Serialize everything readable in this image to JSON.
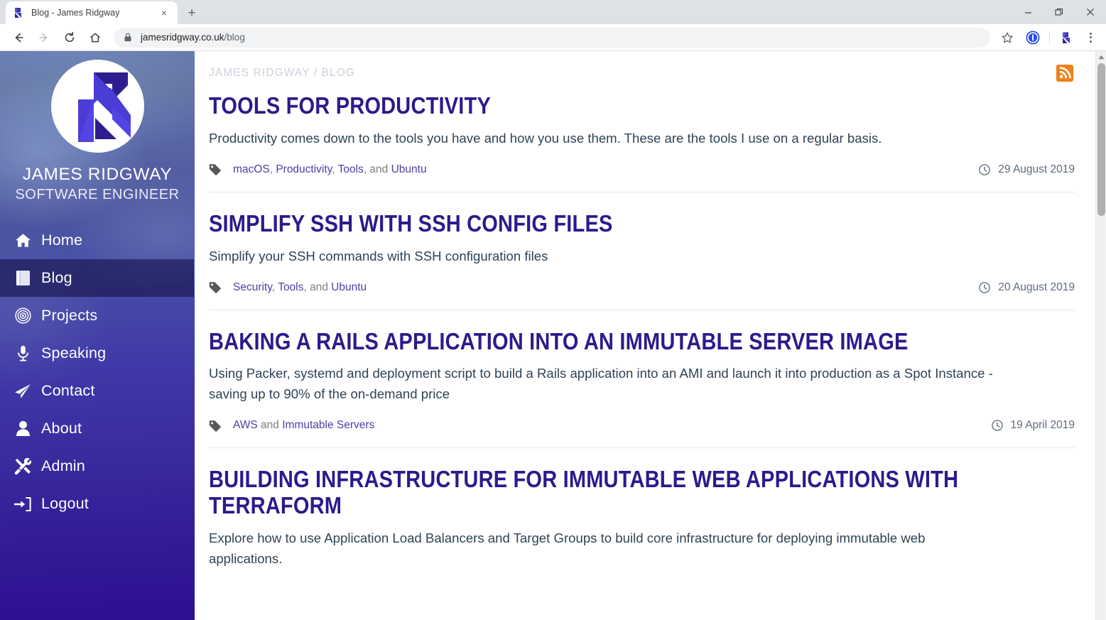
{
  "browser": {
    "tab": {
      "title": "Blog - James Ridgway",
      "favicon_name": "site-logo-favicon",
      "close_label": "×"
    },
    "new_tab_label": "+",
    "window_controls": {
      "minimize_label": "–",
      "maximize_label": "❐",
      "close_label": "✕"
    },
    "nav": {
      "back_label": "←",
      "forward_label": "→",
      "reload_label": "↻",
      "home_label": "⌂"
    },
    "omnibox": {
      "domain": "jamesridgway.co.uk",
      "path": "/blog",
      "lock_icon": "padlock-icon"
    },
    "actions": {
      "bookmark_label": "☆",
      "onepassword_label": "1Password",
      "profile_label": "Profile",
      "menu_label": "Customise and control Google Chrome"
    }
  },
  "sidebar": {
    "brand_name": "JAMES RIDGWAY",
    "brand_role": "SOFTWARE ENGINEER",
    "logo_name": "james-ridgway-logo",
    "items": [
      {
        "label": "Home",
        "icon": "home-icon",
        "active": false
      },
      {
        "label": "Blog",
        "icon": "book-icon",
        "active": true
      },
      {
        "label": "Projects",
        "icon": "bullseye-icon",
        "active": false
      },
      {
        "label": "Speaking",
        "icon": "microphone-icon",
        "active": false
      },
      {
        "label": "Contact",
        "icon": "paper-plane-icon",
        "active": false
      },
      {
        "label": "About",
        "icon": "user-icon",
        "active": false
      },
      {
        "label": "Admin",
        "icon": "tools-icon",
        "active": false
      },
      {
        "label": "Logout",
        "icon": "sign-out-icon",
        "active": false
      }
    ]
  },
  "main": {
    "breadcrumb": "JAMES RIDGWAY / BLOG",
    "rss_label": "RSS Feed",
    "posts": [
      {
        "title": "Tools for Productivity",
        "excerpt": "Productivity comes down to the tools you have and how you use them. These are the tools I use on a regular basis.",
        "tags": [
          "macOS",
          "Productivity",
          "Tools",
          "Ubuntu"
        ],
        "tags_text": "macOS, Productivity, Tools, and Ubuntu",
        "date": "29 August 2019"
      },
      {
        "title": "Simplify SSH with SSH Config Files",
        "excerpt": "Simplify your SSH commands with SSH configuration files",
        "tags": [
          "Security",
          "Tools",
          "Ubuntu"
        ],
        "tags_text": "Security, Tools, and Ubuntu",
        "date": "20 August 2019"
      },
      {
        "title": "Baking a Rails Application into an Immutable Server Image",
        "excerpt": "Using Packer, systemd and deployment script to build a Rails application into an AMI and launch it into production as a Spot Instance - saving up to 90% of the on-demand price",
        "tags": [
          "AWS",
          "Immutable Servers"
        ],
        "tags_text": "AWS and Immutable Servers",
        "date": "19 April 2019"
      },
      {
        "title": "Building Infrastructure for Immutable Web Applications with Terraform",
        "excerpt": "Explore how to use Application Load Balancers and Target Groups to build core infrastructure for deploying immutable web applications.",
        "tags": [],
        "tags_text": "",
        "date": ""
      }
    ]
  },
  "colors": {
    "accent_purple": "#2b1b8c",
    "link_purple": "#4a41a8",
    "rss_orange": "#f08019",
    "sidebar_top": "#6b7fb5",
    "sidebar_bottom": "#2e0f91"
  }
}
